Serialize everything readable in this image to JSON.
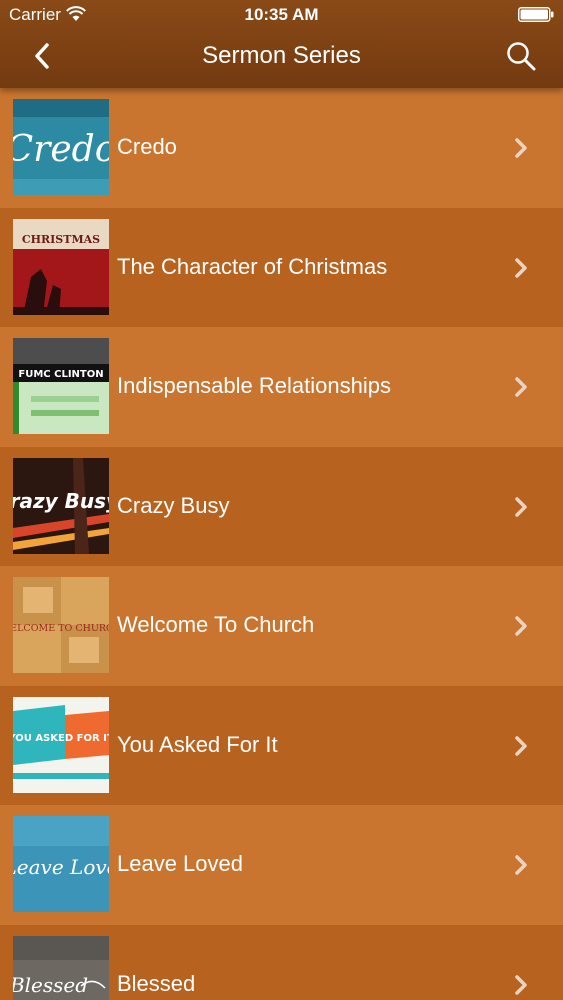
{
  "status_bar": {
    "carrier": "Carrier",
    "time": "10:35 AM"
  },
  "nav": {
    "title": "Sermon Series",
    "back_icon": "chevron-left-icon",
    "search_icon": "search-icon"
  },
  "colors": {
    "header": "#7f4213",
    "row_light": "#c9752f",
    "row_dark": "#b8621f",
    "text": "#ffffff"
  },
  "series": [
    {
      "label": "Credo",
      "thumb_text": "Credo"
    },
    {
      "label": "The Character of Christmas",
      "thumb_text": "CHRISTMAS"
    },
    {
      "label": "Indispensable Relationships",
      "thumb_text": "FUMC CLINTON"
    },
    {
      "label": "Crazy Busy",
      "thumb_text": "Crazy Busy"
    },
    {
      "label": "Welcome To Church",
      "thumb_text": "WELCOME TO CHURCH"
    },
    {
      "label": "You Asked For It",
      "thumb_text": "YOU ASKED FOR IT"
    },
    {
      "label": "Leave Loved",
      "thumb_text": "Leave Love"
    },
    {
      "label": "Blessed",
      "thumb_text": "Blessed"
    }
  ]
}
